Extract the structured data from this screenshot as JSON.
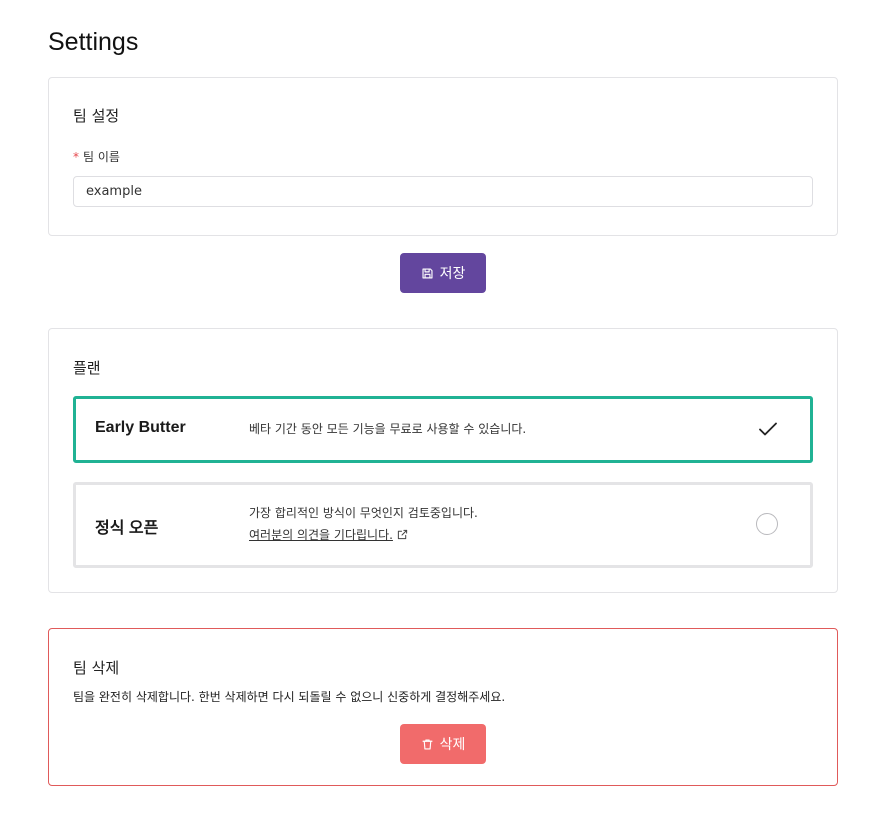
{
  "page": {
    "title": "Settings"
  },
  "team_settings": {
    "title": "팀 설정",
    "name_field": {
      "required_mark": "*",
      "label": "팀 이름",
      "value": "example"
    },
    "save_button": {
      "label": "저장",
      "icon": "save-icon"
    }
  },
  "plan": {
    "title": "플랜",
    "options": [
      {
        "name": "Early Butter",
        "description": "베타 기간 동안 모든 기능을 무료로 사용할 수 있습니다.",
        "selected": true,
        "icon": "check-icon"
      },
      {
        "name": "정식 오픈",
        "description": "가장 합리적인 방식이 무엇인지 검토중입니다.",
        "link_text": "여러분의 의견을 기다립니다.",
        "link_icon": "external-link-icon",
        "selected": false
      }
    ]
  },
  "delete_team": {
    "title": "팀 삭제",
    "description": "팀을 완전히 삭제합니다. 한번 삭제하면 다시 되돌릴 수 없으니 신중하게 결정해주세요.",
    "delete_button": {
      "label": "삭제",
      "icon": "trash-icon"
    }
  },
  "colors": {
    "primary": "#63469e",
    "selected_border": "#20b294",
    "danger": "#f16b6b",
    "danger_border": "#e05a5a",
    "required": "#e5484d"
  }
}
